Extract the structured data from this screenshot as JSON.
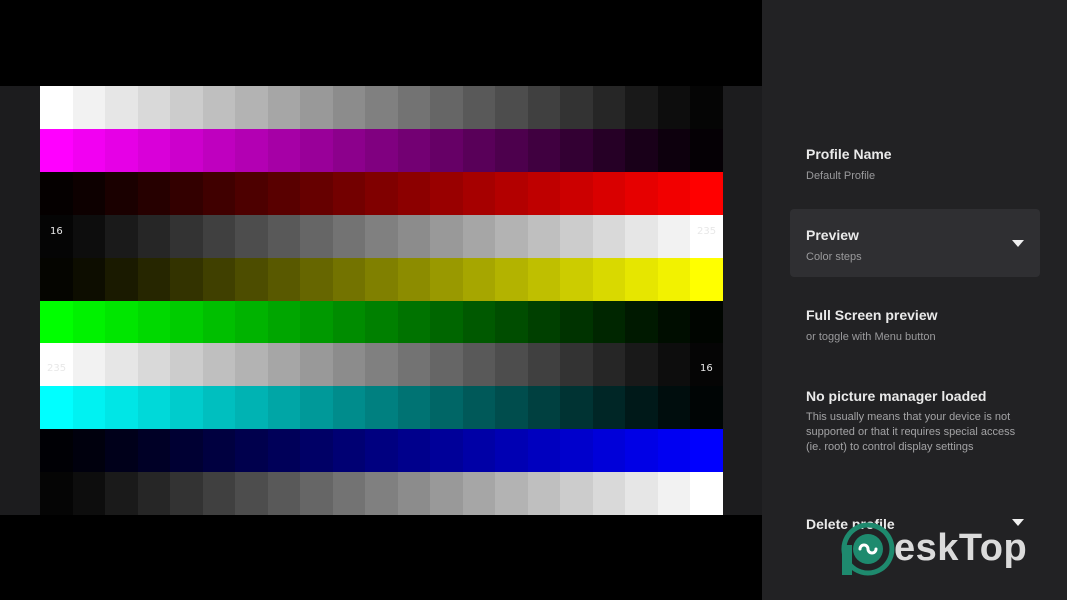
{
  "preview": {
    "label_left_top": "16",
    "label_right_top": "235",
    "label_left_mid": "235",
    "label_right_mid": "16",
    "step_count": 21,
    "bands": [
      {
        "name": "gray-ramp-top",
        "color": "#ffffff",
        "direction": "descending"
      },
      {
        "name": "magenta-ramp",
        "color": "#ff00ff",
        "direction": "descending"
      },
      {
        "name": "red-ramp",
        "color": "#ff0000",
        "direction": "ascending"
      },
      {
        "name": "gray-ramp-2",
        "color": "#ffffff",
        "direction": "ascending"
      },
      {
        "name": "yellow-ramp",
        "color": "#ffff00",
        "direction": "ascending"
      },
      {
        "name": "green-ramp",
        "color": "#00ff00",
        "direction": "descending"
      },
      {
        "name": "gray-ramp-3",
        "color": "#ffffff",
        "direction": "descending"
      },
      {
        "name": "cyan-ramp",
        "color": "#00ffff",
        "direction": "descending"
      },
      {
        "name": "blue-ramp",
        "color": "#0000ff",
        "direction": "ascending"
      },
      {
        "name": "gray-ramp-bottom",
        "color": "#ffffff",
        "direction": "ascending"
      }
    ]
  },
  "settings": {
    "profile_name": {
      "title": "Profile Name",
      "subtitle": "Default Profile"
    },
    "preview": {
      "title": "Preview",
      "subtitle": "Color steps",
      "icon": "dropdown-arrow-icon"
    },
    "full_screen": {
      "title": "Full Screen preview",
      "subtitle": "or toggle with Menu button"
    },
    "no_manager": {
      "title": "No picture manager loaded",
      "subtitle": "This usually means that your device is not supported or that it requires special access (ie. root) to control display settings"
    },
    "delete_profile": {
      "title": "Delete profile",
      "icon": "dropdown-arrow-icon"
    }
  },
  "watermark": {
    "text": "eskTop",
    "logo": "4d-logo-icon",
    "color": "#1e8a6e"
  }
}
